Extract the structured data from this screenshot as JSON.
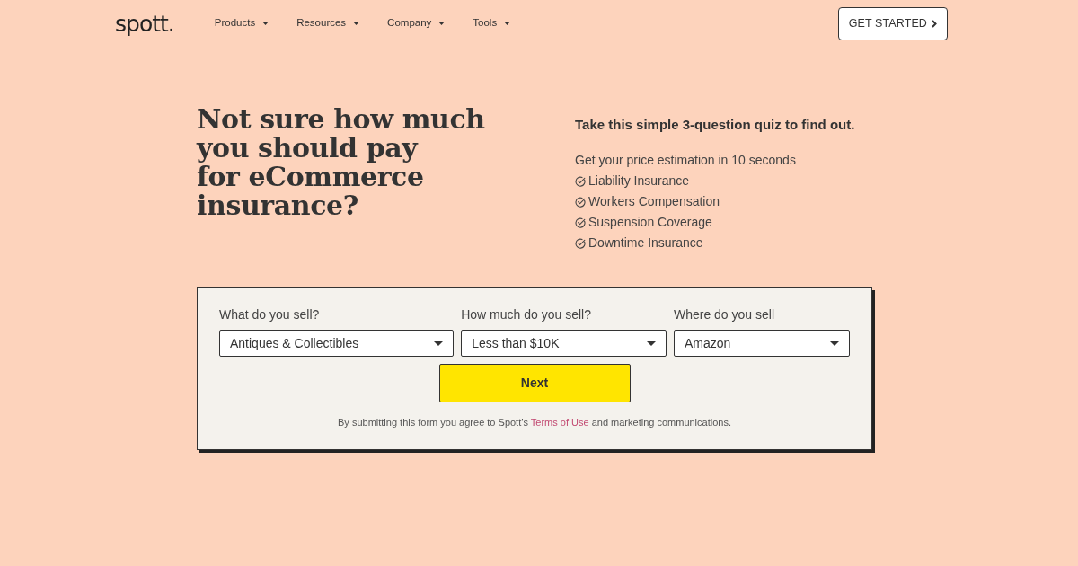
{
  "header": {
    "logo": "spott.",
    "nav": [
      {
        "label": "Products"
      },
      {
        "label": "Resources"
      },
      {
        "label": "Company"
      },
      {
        "label": "Tools"
      }
    ],
    "cta": "GET STARTED"
  },
  "hero": {
    "title": "Not sure how much\nyou should pay\nfor eCommerce\ninsurance?",
    "quiz_heading": "Take this simple 3-question quiz to find out.",
    "subtitle": "Get your price estimation in 10 seconds",
    "benefits": [
      "Liability Insurance",
      "Workers Compensation",
      "Suspension Coverage",
      "Downtime Insurance"
    ]
  },
  "quiz_form": {
    "fields": [
      {
        "label": "What do you sell?",
        "value": "Antiques & Collectibles"
      },
      {
        "label": "How much do you sell?",
        "value": "Less than $10K"
      },
      {
        "label": "Where do you sell",
        "value": "Amazon"
      }
    ],
    "submit": "Next",
    "disclaimer_before": "By submitting this form you agree to Spott’s",
    "disclaimer_link": "Terms of Use",
    "disclaimer_after": "and marketing communications."
  }
}
